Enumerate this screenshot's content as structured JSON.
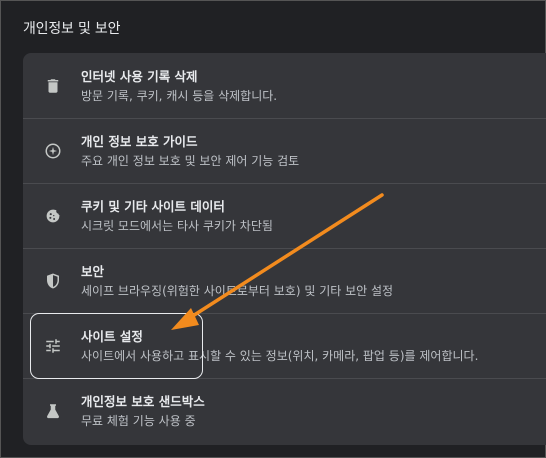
{
  "section": {
    "title": "개인정보 및 보안"
  },
  "items": [
    {
      "icon": "trash-icon",
      "title": "인터넷 사용 기록 삭제",
      "desc": "방문 기록, 쿠키, 캐시 등을 삭제합니다."
    },
    {
      "icon": "privacy-guide-icon",
      "title": "개인 정보 보호 가이드",
      "desc": "주요 개인 정보 보호 및 보안 제어 기능 검토"
    },
    {
      "icon": "cookie-icon",
      "title": "쿠키 및 기타 사이트 데이터",
      "desc": "시크릿 모드에서는 타사 쿠키가 차단됨"
    },
    {
      "icon": "shield-icon",
      "title": "보안",
      "desc": "세이프 브라우징(위험한 사이트로부터 보호) 및 기타 보안 설정"
    },
    {
      "icon": "tune-icon",
      "title": "사이트 설정",
      "desc": "사이트에서 사용하고 표시할 수 있는 정보(위치, 카메라, 팝업 등)를 제어합니다."
    },
    {
      "icon": "flask-icon",
      "title": "개인정보 보호 샌드박스",
      "desc": "무료 체험 기능 사용 중"
    }
  ],
  "colors": {
    "background": "#202124",
    "card": "#35363a",
    "text_primary": "#e8eaed",
    "text_secondary": "#bdc1c6",
    "annotation_arrow": "#f28b1e",
    "annotation_box": "#e8eaed"
  }
}
